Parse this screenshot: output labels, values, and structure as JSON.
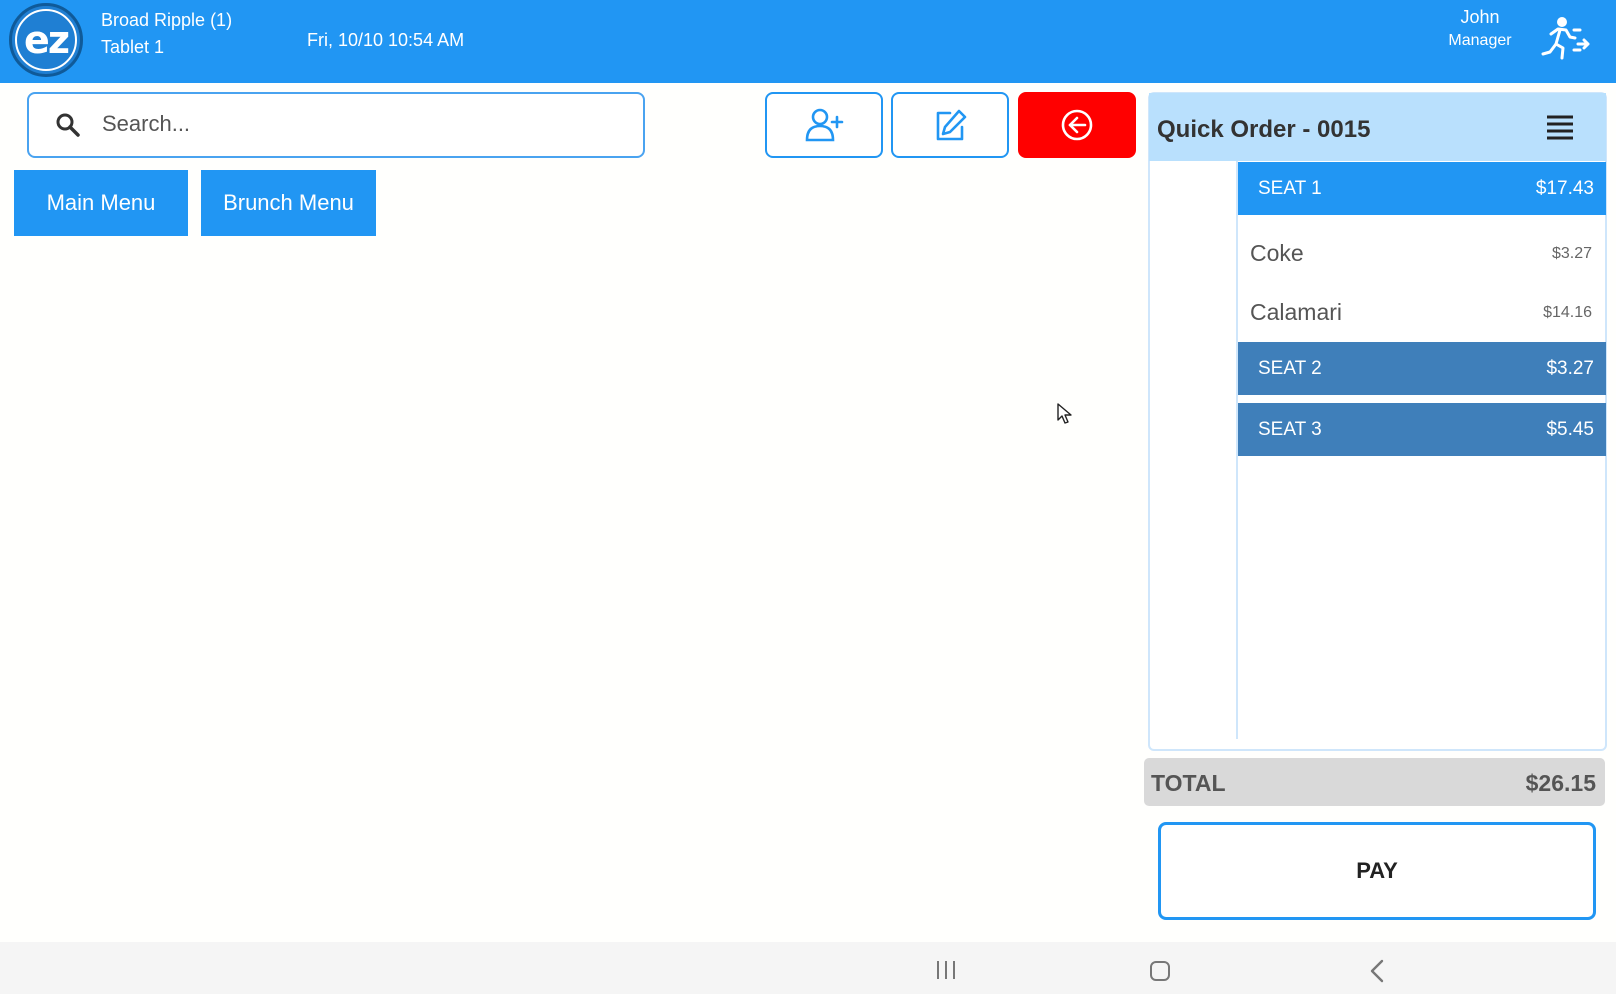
{
  "header": {
    "logo_text": "ez",
    "location": "Broad Ripple (1)",
    "device": "Tablet 1",
    "datetime": "Fri, 10/10 10:54 AM",
    "user_name": "John",
    "user_role": "Manager",
    "logout_icon": "logout-runner-icon"
  },
  "search": {
    "placeholder": "Search...",
    "value": ""
  },
  "actions": {
    "add_guest_icon": "add-person-icon",
    "edit_icon": "edit-icon",
    "back_icon": "arrow-left-circle-icon"
  },
  "menus": [
    {
      "label": "Main Menu"
    },
    {
      "label": "Brunch Menu"
    }
  ],
  "order": {
    "title": "Quick Order - 0015",
    "seats": [
      {
        "label": "SEAT 1",
        "price": "$17.43"
      },
      {
        "label": "SEAT 2",
        "price": "$3.27"
      },
      {
        "label": "SEAT 3",
        "price": "$5.45"
      }
    ],
    "items": [
      {
        "name": "Coke",
        "price": "$3.27"
      },
      {
        "name": "Calamari",
        "price": "$14.16"
      }
    ],
    "total_label": "TOTAL",
    "total_value": "$26.15",
    "pay_label": "PAY"
  },
  "colors": {
    "header_blue": "#2196f3",
    "seat_active": "#2196f3",
    "seat_inactive": "#3f7fba",
    "back_red": "#ff0000",
    "order_header": "#b9e0fd"
  }
}
